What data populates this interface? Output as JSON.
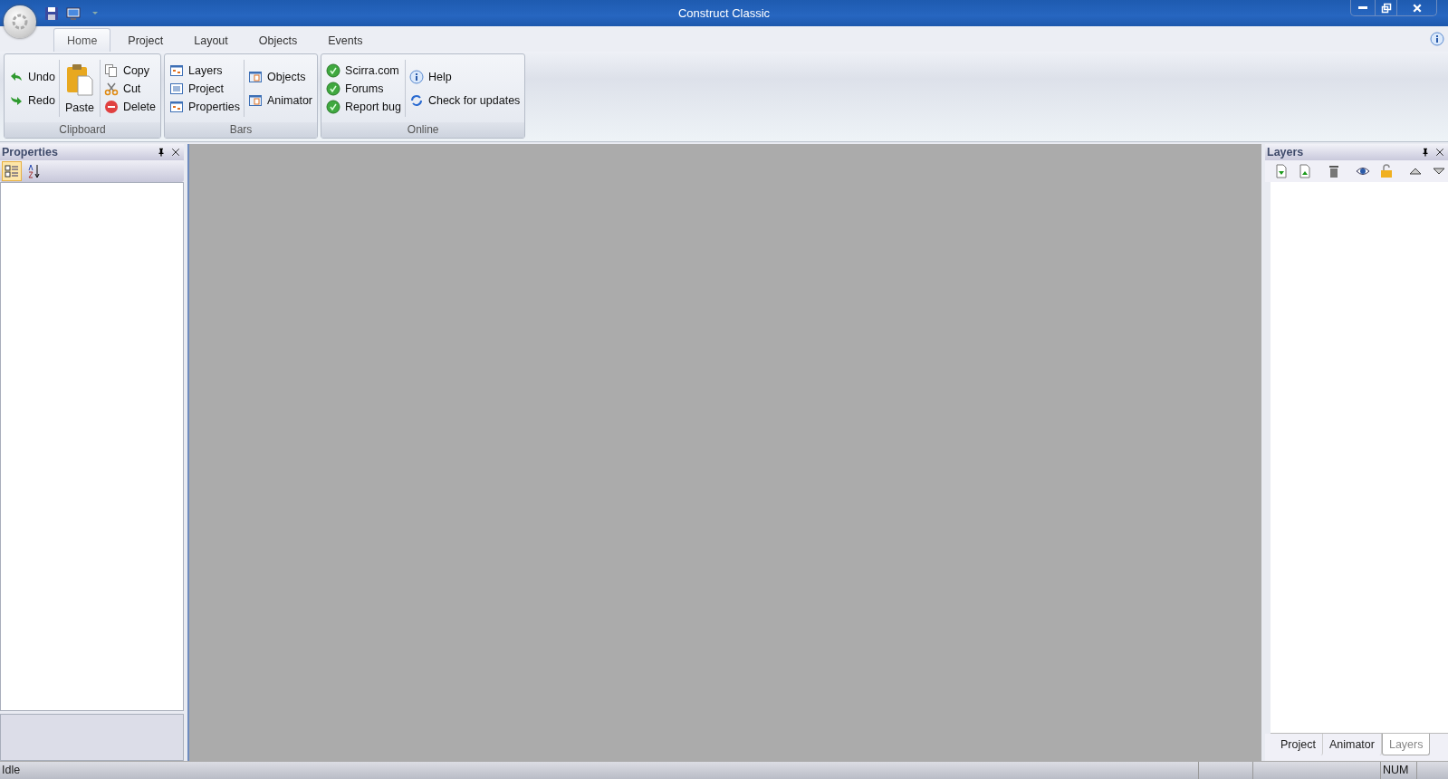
{
  "window": {
    "title": "Construct Classic"
  },
  "ribbon": {
    "tabs": [
      {
        "label": "Home",
        "selected": true
      },
      {
        "label": "Project",
        "selected": false
      },
      {
        "label": "Layout",
        "selected": false
      },
      {
        "label": "Objects",
        "selected": false
      },
      {
        "label": "Events",
        "selected": false
      }
    ],
    "groups": [
      {
        "label": "Clipboard",
        "columns": [
          [
            {
              "label": "Undo",
              "kind": "undo"
            },
            {
              "label": "Redo",
              "kind": "redo"
            }
          ],
          [
            {
              "label": "Paste",
              "kind": "paste"
            }
          ],
          [
            {
              "label": "Copy",
              "kind": "copy"
            },
            {
              "label": "Cut",
              "kind": "cut"
            },
            {
              "label": "Delete",
              "kind": "delete"
            }
          ]
        ]
      },
      {
        "label": "Bars",
        "columns": [
          [
            {
              "label": "Layers",
              "kind": "grid"
            },
            {
              "label": "Project",
              "kind": "list"
            },
            {
              "label": "Properties",
              "kind": "grid"
            }
          ],
          [
            {
              "label": "Objects",
              "kind": "window"
            },
            {
              "label": "Animator",
              "kind": "window"
            }
          ]
        ]
      },
      {
        "label": "Online",
        "columns": [
          [
            {
              "label": "Scirra.com",
              "kind": "globe"
            },
            {
              "label": "Forums",
              "kind": "globe"
            },
            {
              "label": "Report bug",
              "kind": "globe"
            }
          ],
          [
            {
              "label": "Help",
              "kind": "info"
            },
            {
              "label": "Check for updates",
              "kind": "refresh"
            }
          ]
        ]
      }
    ]
  },
  "properties_panel": {
    "title": "Properties"
  },
  "layers_panel": {
    "title": "Layers",
    "tabs": [
      {
        "label": "Project",
        "selected": false
      },
      {
        "label": "Animator",
        "selected": false
      },
      {
        "label": "Layers",
        "selected": true
      }
    ]
  },
  "status_bar": {
    "message": "Idle",
    "indicators": [
      "NUM"
    ]
  }
}
